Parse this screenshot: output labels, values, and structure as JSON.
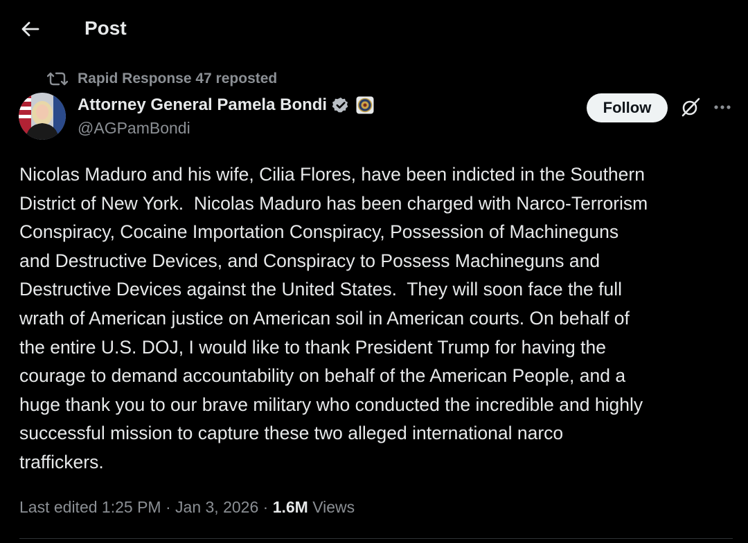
{
  "header": {
    "back_icon": "arrow-left-icon",
    "title": "Post"
  },
  "repost": {
    "icon": "repost-icon",
    "text": "Rapid Response 47 reposted"
  },
  "author": {
    "name": "Attorney General Pamela Bondi",
    "handle": "@AGPamBondi",
    "verified_icon": "verified-badge-icon",
    "affiliation_icon": "doj-seal-icon"
  },
  "actions": {
    "follow_label": "Follow",
    "grok_icon": "grok-icon",
    "more_icon": "more-dots-icon"
  },
  "post": {
    "lines": [
      "Nicolas Maduro and his wife, Cilia Flores, have been indicted in the Southern",
      "District of New York.  Nicolas Maduro has been charged with Narco-Terrorism",
      "Conspiracy, Cocaine Importation Conspiracy, Possession of Machineguns",
      "and Destructive Devices, and Conspiracy to Possess Machineguns and",
      "Destructive Devices against the United States.  They will soon face the full",
      "wrath of American justice on American soil in American courts. On behalf of",
      "the entire U.S. DOJ, I would like to thank President Trump for having the",
      "courage to demand accountability on behalf of the American People, and a",
      "huge thank you to our brave military who conducted the incredible and highly",
      "successful mission to capture these two alleged international narco",
      "traffickers."
    ]
  },
  "meta": {
    "edited_prefix": "Last edited ",
    "time": "1:25 PM",
    "separator": " · ",
    "date": "Jan 3, 2026",
    "views_count": "1.6M",
    "views_label": " Views"
  },
  "colors": {
    "background": "#000000",
    "text_primary": "#e7e9ea",
    "text_secondary": "#8b8f94",
    "verified_blue": "#1d9bf0",
    "follow_bg": "#eff3f4"
  }
}
